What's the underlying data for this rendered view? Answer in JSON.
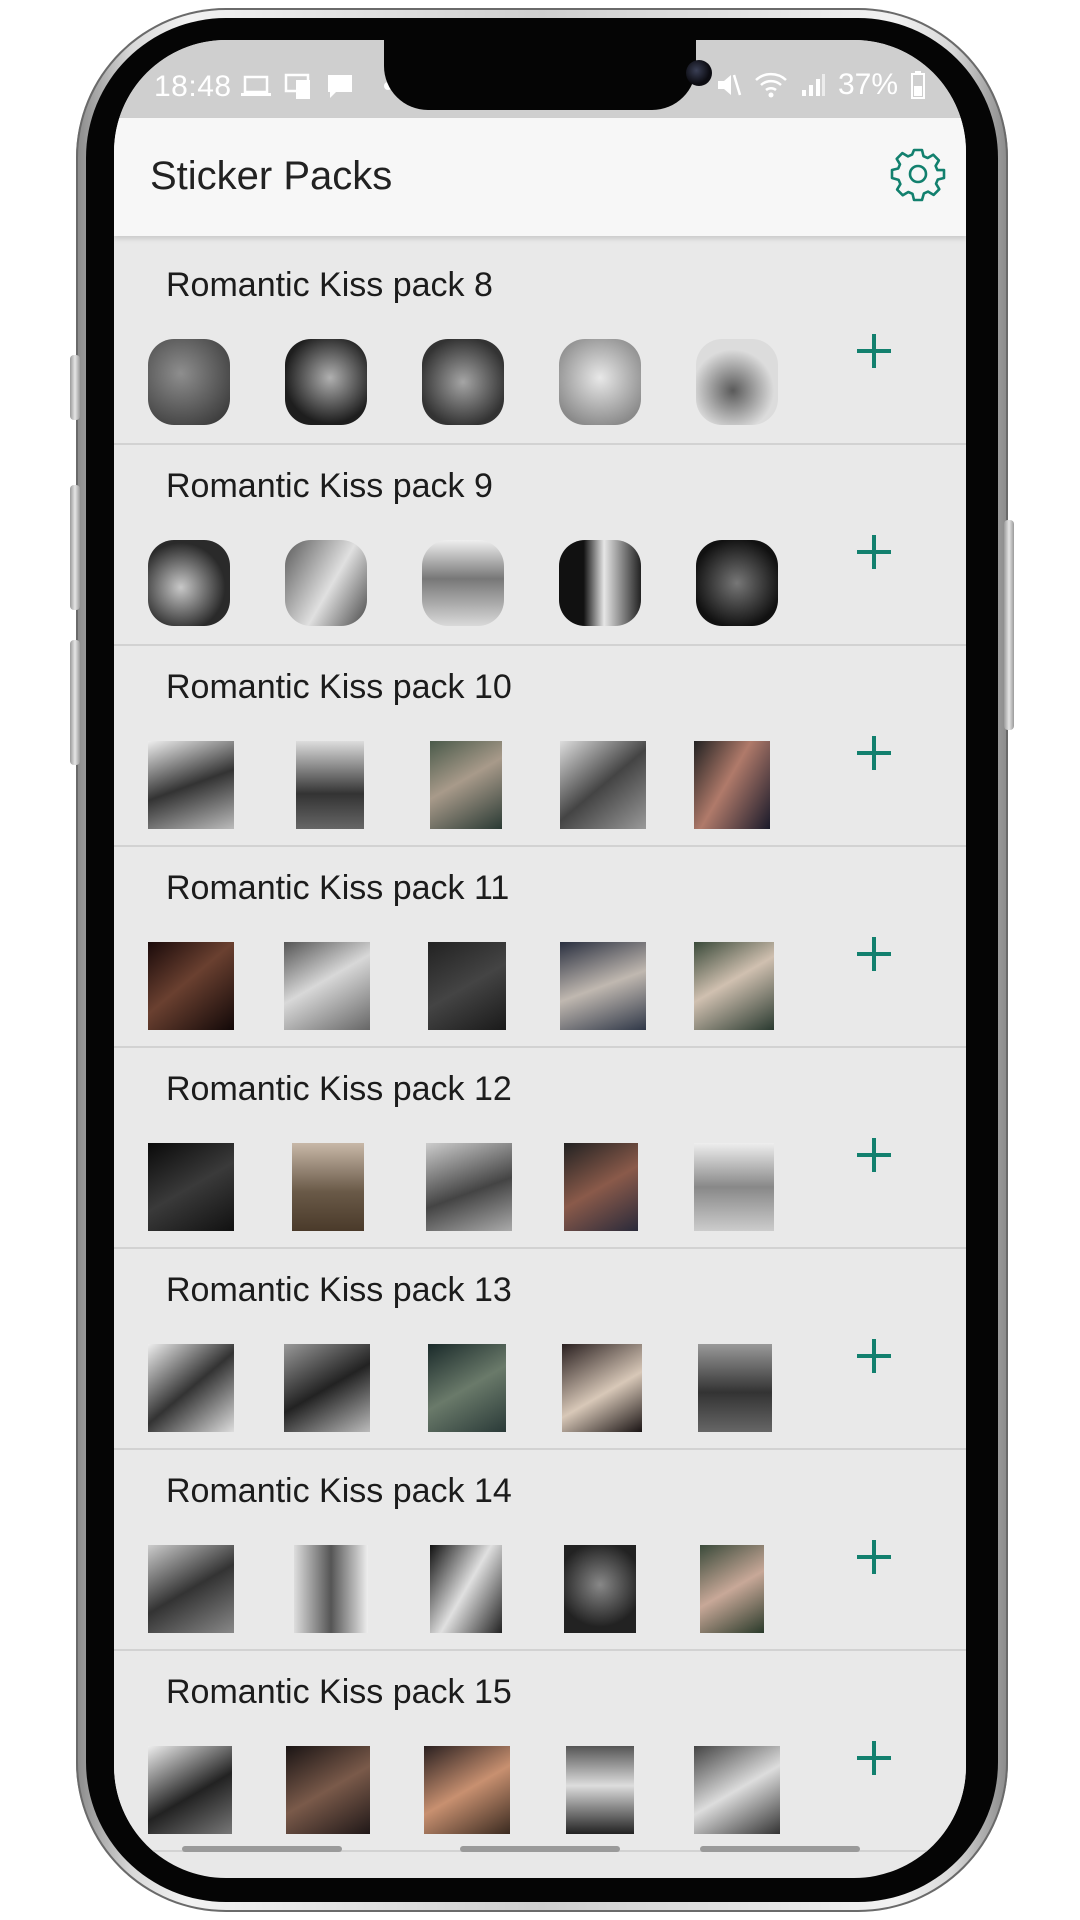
{
  "status": {
    "time": "18:48",
    "battery": "37%"
  },
  "appbar": {
    "title": "Sticker Packs",
    "settings_icon": "gear-icon"
  },
  "colors": {
    "accent": "#12806e",
    "list_bg": "#e9e9e9",
    "appbar_bg": "#f7f7f7"
  },
  "packs": [
    {
      "name": "Romantic Kiss pack 8"
    },
    {
      "name": "Romantic Kiss pack 9"
    },
    {
      "name": "Romantic Kiss pack 10"
    },
    {
      "name": "Romantic Kiss pack 11"
    },
    {
      "name": "Romantic Kiss pack 12"
    },
    {
      "name": "Romantic Kiss pack 13"
    },
    {
      "name": "Romantic Kiss pack 14"
    },
    {
      "name": "Romantic Kiss pack 15"
    }
  ]
}
